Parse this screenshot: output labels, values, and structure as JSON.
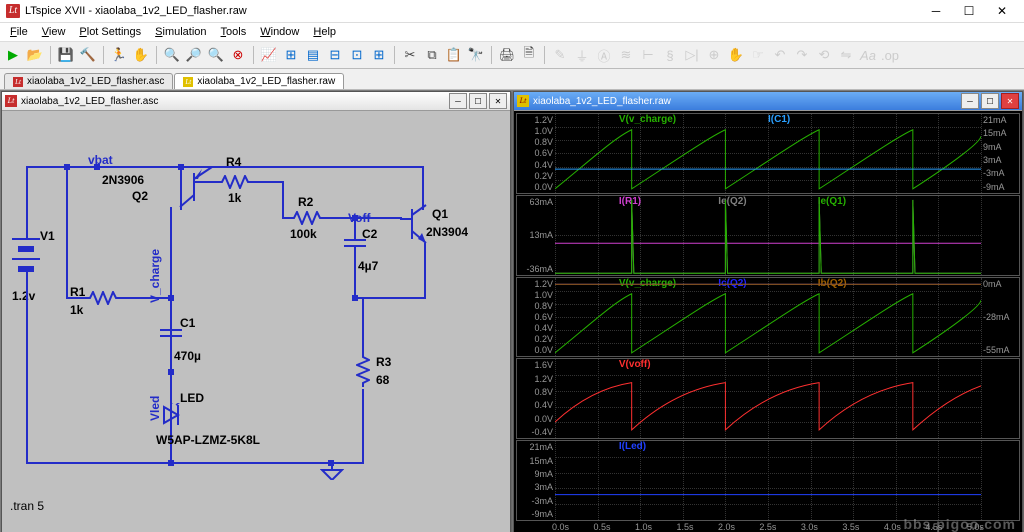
{
  "window": {
    "title": "LTspice XVII - xiaolaba_1v2_LED_flasher.raw"
  },
  "menu": {
    "file": "File",
    "view": "View",
    "plot": "Plot Settings",
    "sim": "Simulation",
    "tools": "Tools",
    "window": "Window",
    "help": "Help"
  },
  "tabs": [
    {
      "label": "xiaolaba_1v2_LED_flasher.asc",
      "active": false,
      "kind": "asc"
    },
    {
      "label": "xiaolaba_1v2_LED_flasher.raw",
      "active": true,
      "kind": "raw"
    }
  ],
  "child": {
    "left": {
      "title": "xiaolaba_1v2_LED_flasher.asc"
    },
    "right": {
      "title": "xiaolaba_1v2_LED_flasher.raw"
    }
  },
  "schematic": {
    "nets": {
      "vbat": "vbat",
      "vcharge": "V_charge",
      "vled": "Vled",
      "voff": "Voff"
    },
    "parts": {
      "V1": {
        "name": "V1",
        "val": "1.2v"
      },
      "R1": {
        "name": "R1",
        "val": "1k"
      },
      "R2": {
        "name": "R2",
        "val": "100k"
      },
      "R3": {
        "name": "R3",
        "val": "68"
      },
      "R4": {
        "name": "R4",
        "val": "1k"
      },
      "C1": {
        "name": "C1",
        "val": "470µ"
      },
      "C2": {
        "name": "C2",
        "val": "4µ7"
      },
      "Q1": {
        "name": "Q1",
        "val": "2N3904"
      },
      "Q2": {
        "name": "Q2",
        "val": "2N3906"
      },
      "LED": {
        "name": "LED",
        "val": "W5AP-LZMZ-5K8L"
      }
    },
    "directive": ".tran 5"
  },
  "plots": {
    "xticks": [
      "0.0s",
      "0.5s",
      "1.0s",
      "1.5s",
      "2.0s",
      "2.5s",
      "3.0s",
      "3.5s",
      "4.0s",
      "4.5s",
      "5.0s"
    ],
    "panes": [
      {
        "yl": [
          "1.2V",
          "1.0V",
          "0.8V",
          "0.6V",
          "0.4V",
          "0.2V",
          "0.0V"
        ],
        "yr": [
          "21mA",
          "15mA",
          "9mA",
          "3mA",
          "-3mA",
          "-9mA"
        ],
        "traces": [
          {
            "label": "V(v_charge)",
            "color": "#26b000"
          },
          {
            "label": "I(C1)",
            "color": "#2aa0ff"
          }
        ]
      },
      {
        "yl": [
          "63mA",
          "13mA",
          "-36mA"
        ],
        "yr": [],
        "traces": [
          {
            "label": "I(R1)",
            "color": "#d040d0"
          },
          {
            "label": "Ie(Q2)",
            "color": "#808080"
          },
          {
            "label": "Ie(Q1)",
            "color": "#26b000"
          }
        ]
      },
      {
        "yl": [
          "1.2V",
          "1.0V",
          "0.8V",
          "0.6V",
          "0.4V",
          "0.2V",
          "0.0V"
        ],
        "yr": [
          "0mA",
          "-28mA",
          "-55mA"
        ],
        "traces": [
          {
            "label": "V(v_charge)",
            "color": "#26b000"
          },
          {
            "label": "Ic(Q2)",
            "color": "#2020ff"
          },
          {
            "label": "Ib(Q2)",
            "color": "#a06000"
          }
        ]
      },
      {
        "yl": [
          "1.6V",
          "1.2V",
          "0.8V",
          "0.4V",
          "0.0V",
          "-0.4V"
        ],
        "yr": [],
        "traces": [
          {
            "label": "V(voff)",
            "color": "#ff3030"
          }
        ]
      },
      {
        "yl": [
          "21mA",
          "15mA",
          "9mA",
          "3mA",
          "-3mA",
          "-9mA"
        ],
        "yr": [],
        "traces": [
          {
            "label": "I(Led)",
            "color": "#2040ff"
          }
        ]
      }
    ]
  },
  "watermark": "bbs.pigoo.com"
}
